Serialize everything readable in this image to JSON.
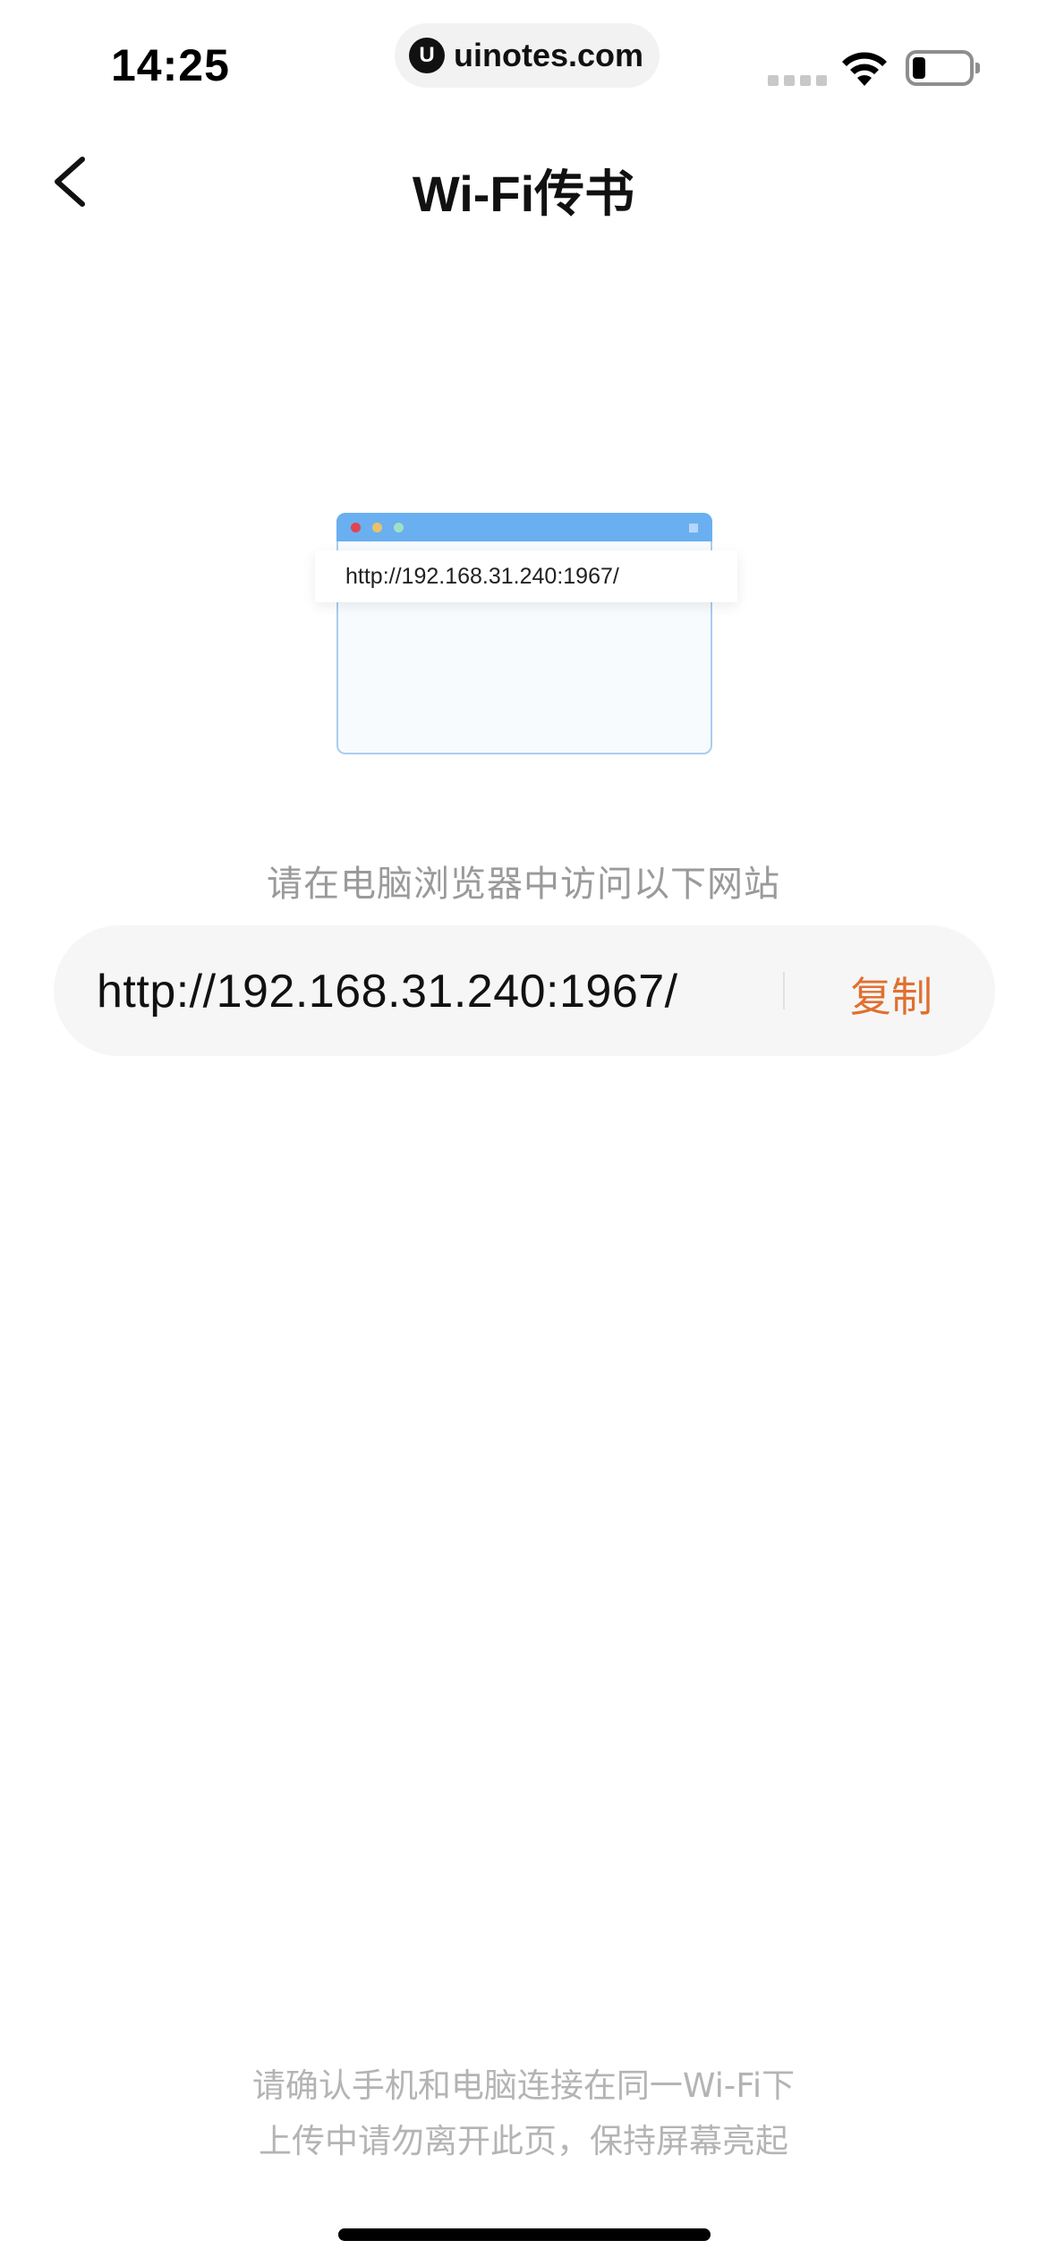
{
  "status_bar": {
    "time": "14:25",
    "watermark": "uinotes.com",
    "watermark_logo": "U",
    "icons": [
      "signal-icon",
      "wifi-icon",
      "battery-icon"
    ]
  },
  "nav": {
    "title": "Wi-Fi传书",
    "back_icon": "chevron-left-icon"
  },
  "illustration": {
    "url": "http://192.168.31.240:1967/"
  },
  "main": {
    "hint": "请在电脑浏览器中访问以下网站",
    "url": "http://192.168.31.240:1967/",
    "copy_label": "复制"
  },
  "footer": {
    "line1": "请确认手机和电脑连接在同一Wi-Fi下",
    "line2": "上传中请勿离开此页，保持屏幕亮起"
  },
  "colors": {
    "accent": "#e07030",
    "browser_bar": "#6aaff0",
    "hint_text": "#9a9a9a"
  }
}
